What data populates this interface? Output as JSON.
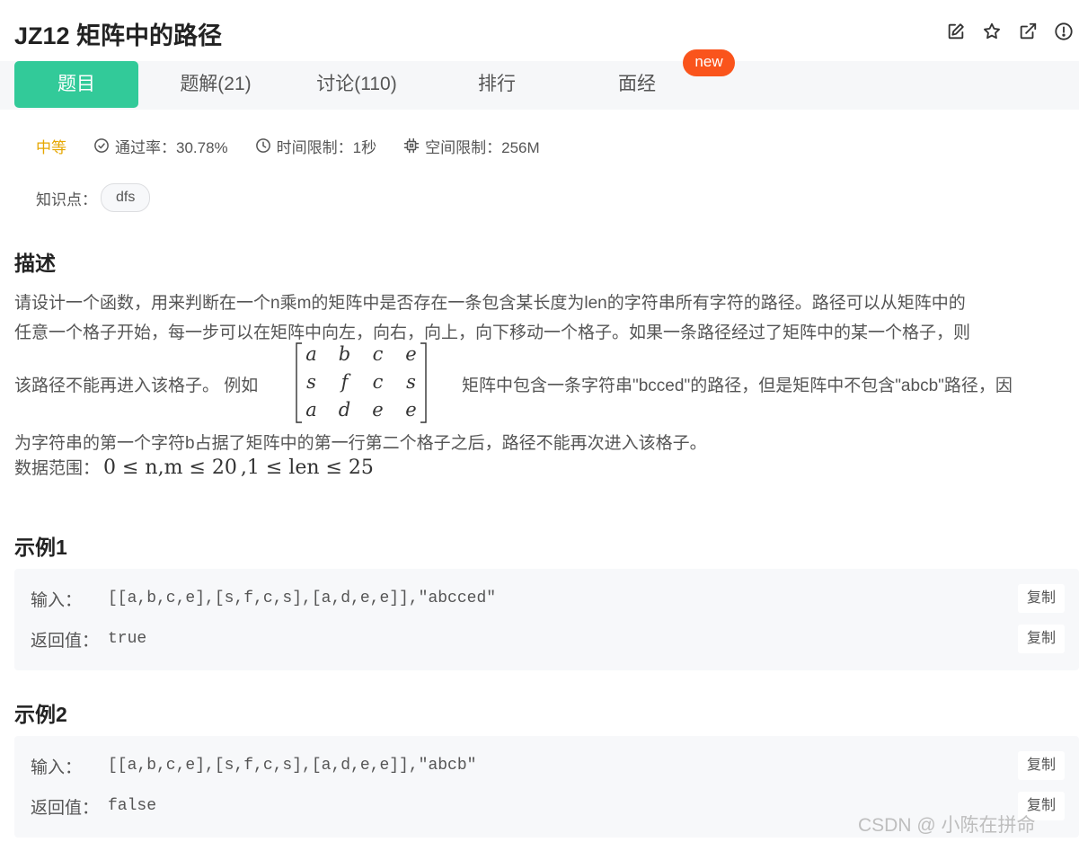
{
  "header": {
    "title": "JZ12  矩阵中的路径",
    "icons": [
      "edit-icon",
      "star-icon",
      "external-link-icon",
      "alert-icon"
    ]
  },
  "tabs": [
    {
      "label": "题目",
      "active": true
    },
    {
      "label": "题解(21)",
      "active": false
    },
    {
      "label": "讨论(110)",
      "active": false
    },
    {
      "label": "排行",
      "active": false
    },
    {
      "label": "面经",
      "active": false
    }
  ],
  "badge": {
    "label": "new",
    "color": "#fa541c"
  },
  "meta": {
    "difficulty": "中等",
    "pass_rate": "通过率：30.78%",
    "time_limit": "时间限制：1秒",
    "space_limit": "空间限制：256M"
  },
  "knowledge": {
    "label": "知识点：",
    "tags": [
      "dfs"
    ]
  },
  "description": {
    "title": "描述",
    "line1": "请设计一个函数，用来判断在一个n乘m的矩阵中是否存在一条包含某长度为len的字符串所有字符的路径。路径可以从矩阵中的",
    "line2": "任意一个格子开始，每一步可以在矩阵中向左，向右，向上，向下移动一个格子。如果一条路径经过了矩阵中的某一个格子，则",
    "line3a": "该路径不能再进入该格子。 例如",
    "line3b": "矩阵中包含一条字符串\"bcced\"的路径，但是矩阵中不包含\"abcb\"路径，因",
    "line4": "为字符串的第一个字符b占据了矩阵中的第一行第二个格子之后，路径不能再次进入该格子。",
    "matrix": [
      [
        "a",
        "b",
        "c",
        "e"
      ],
      [
        "s",
        "f",
        "c",
        "s"
      ],
      [
        "a",
        "d",
        "e",
        "e"
      ]
    ],
    "range_label": "数据范围：",
    "range_math1": "0 ≤ n,m ≤ 20",
    "range_math2": ",1 ≤ len ≤ 25"
  },
  "examples": [
    {
      "title": "示例1",
      "input_label": "输入：",
      "input": "[[a,b,c,e],[s,f,c,s],[a,d,e,e]],\"abcced\"",
      "output_label": "返回值：",
      "output": "true",
      "copy_label": "复制"
    },
    {
      "title": "示例2",
      "input_label": "输入：",
      "input": "[[a,b,c,e],[s,f,c,s],[a,d,e,e]],\"abcb\"",
      "output_label": "返回值：",
      "output": "false",
      "copy_label": "复制"
    }
  ],
  "watermark": "CSDN @ 小陈在拼命",
  "colors": {
    "accent": "#32ca99",
    "difficulty": "#e6a700",
    "badge": "#fa541c"
  }
}
